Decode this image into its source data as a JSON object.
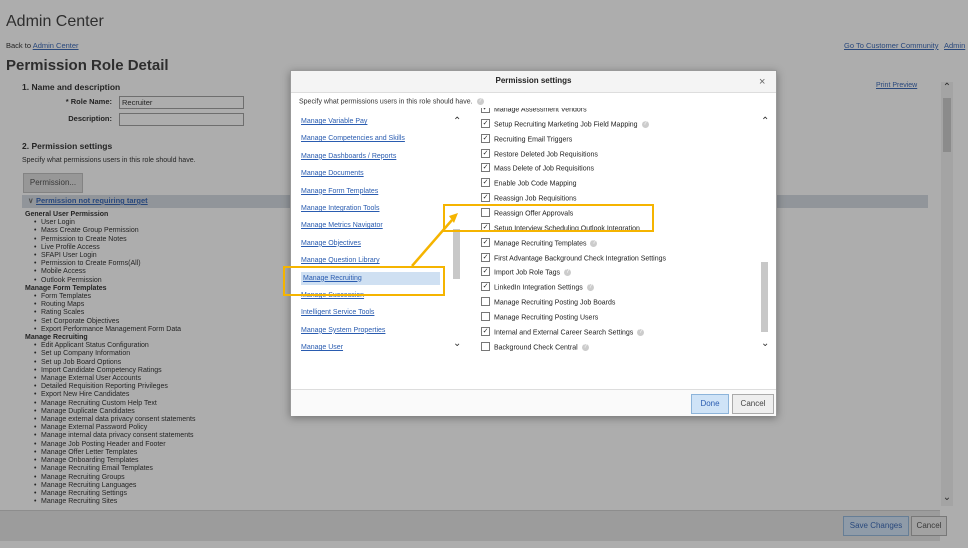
{
  "page": {
    "app_title": "Admin Center",
    "back_prefix": "Back to",
    "back_link": "Admin Center",
    "page_title": "Permission Role Detail",
    "go_to_customer_community": "Go To Customer Community",
    "admin_link": "Admin",
    "section1": "1. Name and description",
    "print_preview": "Print Preview",
    "role_name_label": "* Role Name:",
    "role_name_value": "Recruiter",
    "description_label": "Description:",
    "description_value": "",
    "section2": "2. Permission settings",
    "section2_desc": "Specify what permissions users in this role should have.",
    "permission_button": "Permission...",
    "permission_bar": "Permission not requiring target",
    "save_changes": "Save Changes",
    "cancel": "Cancel"
  },
  "background_permissions": [
    {
      "group": "General User Permission",
      "items": [
        "User Login",
        "Mass Create Group Permission",
        "Permission to Create Notes",
        "Live Profile Access",
        "SFAPI User Login",
        "Permission to Create Forms(All)",
        "Mobile Access",
        "Outlook Permission"
      ]
    },
    {
      "group": "Manage Form Templates",
      "items": [
        "Form Templates",
        "Routing Maps",
        "Rating Scales",
        "Set Corporate Objectives",
        "Export Performance Management Form Data"
      ]
    },
    {
      "group": "Manage Recruiting",
      "items": [
        "Edit Applicant Status Configuration",
        "Set up Company Information",
        "Set up Job Board Options",
        "Import Candidate Competency Ratings",
        "Manage External User Accounts",
        "Detailed Requisition Reporting Privileges",
        "Export New Hire Candidates",
        "Manage Recruiting Custom Help Text",
        "Manage Duplicate Candidates",
        "Manage external data privacy consent statements",
        "Manage External Password Policy",
        "Manage internal data privacy consent statements",
        "Manage Job Posting Header and Footer",
        "Manage Offer Letter Templates",
        "Manage Onboarding Templates",
        "Manage Recruiting Email Templates",
        "Manage Recruiting Groups",
        "Manage Recruiting Languages",
        "Manage Recruiting Settings",
        "Manage Recruiting Sites"
      ]
    }
  ],
  "dialog": {
    "title": "Permission settings",
    "close": "×",
    "description": "Specify what permissions users in this role should have.",
    "categories": [
      "Manage Variable Pay",
      "Manage Competencies and Skills",
      "Manage Dashboards / Reports",
      "Manage Documents",
      "Manage Form Templates",
      "Manage Integration Tools",
      "Manage Metrics Navigator",
      "Manage Objectives",
      "Manage Question Library",
      "Manage Recruiting",
      "Manage Succession",
      "Intelligent Service Tools",
      "Manage System Properties",
      "Manage User"
    ],
    "selected_category": "Manage Recruiting",
    "permissions": [
      {
        "label": "Manage Assessment Vendors",
        "checked": true,
        "help": false
      },
      {
        "label": "Setup Recruiting Marketing Job Field Mapping",
        "checked": true,
        "help": true
      },
      {
        "label": "Recruiting Email Triggers",
        "checked": true,
        "help": false
      },
      {
        "label": "Restore Deleted Job Requisitions",
        "checked": true,
        "help": false
      },
      {
        "label": "Mass Delete of Job Requisitions",
        "checked": true,
        "help": false
      },
      {
        "label": "Enable Job Code Mapping",
        "checked": true,
        "help": false
      },
      {
        "label": "Reassign Job Requisitions",
        "checked": true,
        "help": false
      },
      {
        "label": "Reassign Offer Approvals",
        "checked": false,
        "help": false
      },
      {
        "label": "Setup Interview Scheduling Outlook Integration",
        "checked": true,
        "help": false
      },
      {
        "label": "Manage Recruiting Templates",
        "checked": true,
        "help": true
      },
      {
        "label": "First Advantage Background Check Integration Settings",
        "checked": true,
        "help": false
      },
      {
        "label": "Import Job Role Tags",
        "checked": true,
        "help": true
      },
      {
        "label": "LinkedIn Integration Settings",
        "checked": true,
        "help": true
      },
      {
        "label": "Manage Recruiting Posting Job Boards",
        "checked": false,
        "help": false
      },
      {
        "label": "Manage Recruiting Posting Users",
        "checked": false,
        "help": false
      },
      {
        "label": "Internal and External Career Search Settings",
        "checked": true,
        "help": true
      },
      {
        "label": "Background Check Central",
        "checked": false,
        "help": true
      }
    ],
    "done": "Done",
    "cancel": "Cancel"
  },
  "colors": {
    "highlight": "#f5b400",
    "link": "#2a5cb0",
    "selected_row": "#cfe0f2"
  }
}
